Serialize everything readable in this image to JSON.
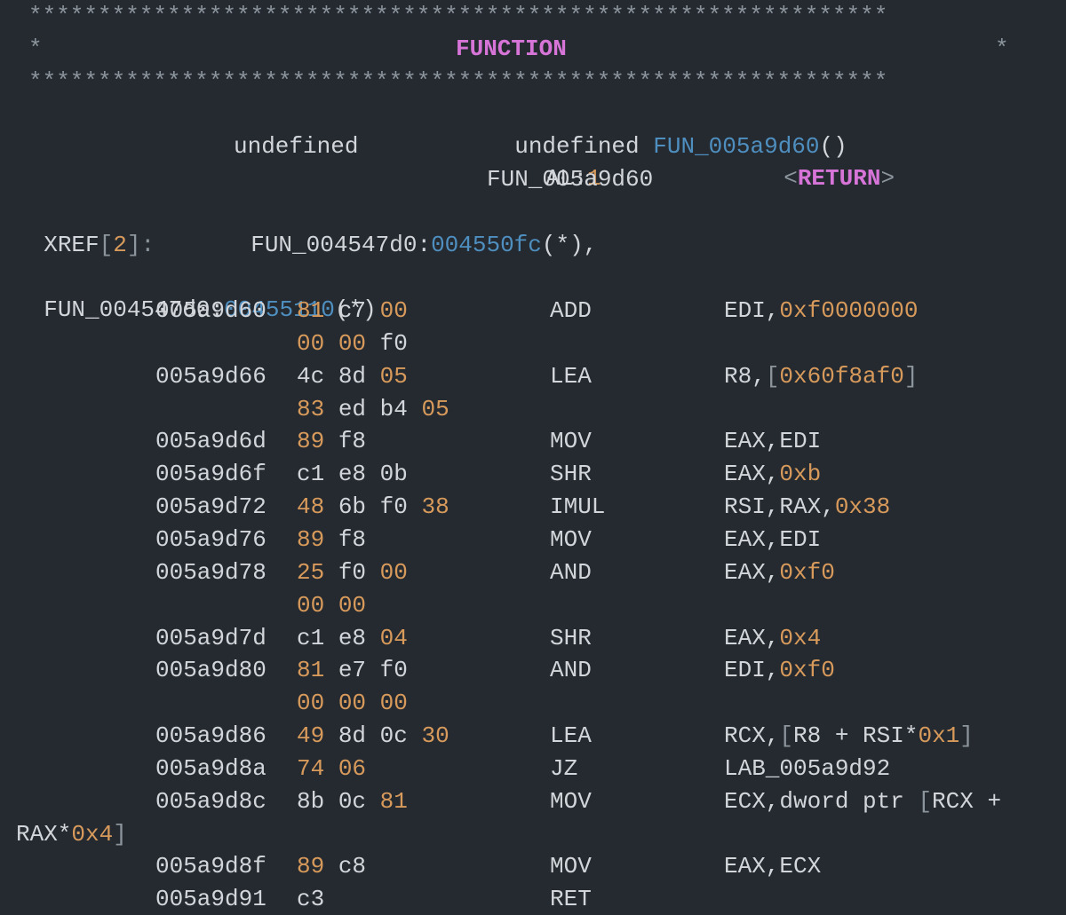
{
  "header": {
    "stars_full": "**************************************************************",
    "left_star": "*",
    "title": "FUNCTION",
    "right_star": "*"
  },
  "signature": {
    "return_type": "undefined",
    "function_name": "FUN_005a9d60",
    "parens": "()"
  },
  "return_row": {
    "type": "undefined",
    "storage_reg": "AL",
    "colon": ":",
    "storage_size": "1",
    "lt": "<",
    "return_label": "RETURN",
    "gt": ">"
  },
  "label": "FUN_005a9d60",
  "xref": {
    "label": "XREF",
    "lbracket": "[",
    "count": "2",
    "rbracket_colon": "]:",
    "ref1_func": "FUN_004547d0:",
    "ref1_addr": "004550fc",
    "ref1_suffix": "(*),",
    "ref2_func": "FUN_004547d0:",
    "ref2_addr": "00455110",
    "ref2_suffix": "(*)"
  },
  "instructions": [
    {
      "address": "005a9d60",
      "bytes": [
        {
          "t": "81",
          "c": "orange"
        },
        {
          "t": "c7",
          "c": "white"
        },
        {
          "t": "00",
          "c": "orange"
        }
      ],
      "mnemonic": "ADD",
      "operands": [
        {
          "t": "EDI,",
          "c": "white"
        },
        {
          "t": "0xf0000000",
          "c": "orange"
        }
      ],
      "cont_bytes": [
        {
          "t": "00",
          "c": "orange"
        },
        {
          "t": "00",
          "c": "orange"
        },
        {
          "t": "f0",
          "c": "white"
        }
      ]
    },
    {
      "address": "005a9d66",
      "bytes": [
        {
          "t": "4c",
          "c": "white"
        },
        {
          "t": "8d",
          "c": "white"
        },
        {
          "t": "05",
          "c": "orange"
        }
      ],
      "mnemonic": "LEA",
      "operands": [
        {
          "t": "R8,",
          "c": "white"
        },
        {
          "t": "[",
          "c": "gray"
        },
        {
          "t": "0x60f8af0",
          "c": "orange"
        },
        {
          "t": "]",
          "c": "gray"
        }
      ],
      "cont_bytes": [
        {
          "t": "83",
          "c": "orange"
        },
        {
          "t": "ed",
          "c": "white"
        },
        {
          "t": "b4",
          "c": "white"
        },
        {
          "t": "05",
          "c": "orange"
        }
      ]
    },
    {
      "address": "005a9d6d",
      "bytes": [
        {
          "t": "89",
          "c": "orange"
        },
        {
          "t": "f8",
          "c": "white"
        }
      ],
      "mnemonic": "MOV",
      "operands": [
        {
          "t": "EAX,EDI",
          "c": "white"
        }
      ]
    },
    {
      "address": "005a9d6f",
      "bytes": [
        {
          "t": "c1",
          "c": "white"
        },
        {
          "t": "e8",
          "c": "white"
        },
        {
          "t": "0b",
          "c": "white"
        }
      ],
      "mnemonic": "SHR",
      "operands": [
        {
          "t": "EAX,",
          "c": "white"
        },
        {
          "t": "0xb",
          "c": "orange"
        }
      ]
    },
    {
      "address": "005a9d72",
      "bytes": [
        {
          "t": "48",
          "c": "orange"
        },
        {
          "t": "6b",
          "c": "white"
        },
        {
          "t": "f0",
          "c": "white"
        },
        {
          "t": "38",
          "c": "orange"
        }
      ],
      "mnemonic": "IMUL",
      "operands": [
        {
          "t": "RSI,RAX,",
          "c": "white"
        },
        {
          "t": "0x38",
          "c": "orange"
        }
      ]
    },
    {
      "address": "005a9d76",
      "bytes": [
        {
          "t": "89",
          "c": "orange"
        },
        {
          "t": "f8",
          "c": "white"
        }
      ],
      "mnemonic": "MOV",
      "operands": [
        {
          "t": "EAX,EDI",
          "c": "white"
        }
      ]
    },
    {
      "address": "005a9d78",
      "bytes": [
        {
          "t": "25",
          "c": "orange"
        },
        {
          "t": "f0",
          "c": "white"
        },
        {
          "t": "00",
          "c": "orange"
        }
      ],
      "mnemonic": "AND",
      "operands": [
        {
          "t": "EAX,",
          "c": "white"
        },
        {
          "t": "0xf0",
          "c": "orange"
        }
      ],
      "cont_bytes": [
        {
          "t": "00",
          "c": "orange"
        },
        {
          "t": "00",
          "c": "orange"
        }
      ]
    },
    {
      "address": "005a9d7d",
      "bytes": [
        {
          "t": "c1",
          "c": "white"
        },
        {
          "t": "e8",
          "c": "white"
        },
        {
          "t": "04",
          "c": "orange"
        }
      ],
      "mnemonic": "SHR",
      "operands": [
        {
          "t": "EAX,",
          "c": "white"
        },
        {
          "t": "0x4",
          "c": "orange"
        }
      ]
    },
    {
      "address": "005a9d80",
      "bytes": [
        {
          "t": "81",
          "c": "orange"
        },
        {
          "t": "e7",
          "c": "white"
        },
        {
          "t": "f0",
          "c": "white"
        }
      ],
      "mnemonic": "AND",
      "operands": [
        {
          "t": "EDI,",
          "c": "white"
        },
        {
          "t": "0xf0",
          "c": "orange"
        }
      ],
      "cont_bytes": [
        {
          "t": "00",
          "c": "orange"
        },
        {
          "t": "00",
          "c": "orange"
        },
        {
          "t": "00",
          "c": "orange"
        }
      ]
    },
    {
      "address": "005a9d86",
      "bytes": [
        {
          "t": "49",
          "c": "orange"
        },
        {
          "t": "8d",
          "c": "white"
        },
        {
          "t": "0c",
          "c": "white"
        },
        {
          "t": "30",
          "c": "orange"
        }
      ],
      "mnemonic": "LEA",
      "operands": [
        {
          "t": "RCX,",
          "c": "white"
        },
        {
          "t": "[",
          "c": "gray"
        },
        {
          "t": "R8 + RSI*",
          "c": "white"
        },
        {
          "t": "0x1",
          "c": "orange"
        },
        {
          "t": "]",
          "c": "gray"
        }
      ]
    },
    {
      "address": "005a9d8a",
      "bytes": [
        {
          "t": "74",
          "c": "orange"
        },
        {
          "t": "06",
          "c": "orange"
        }
      ],
      "mnemonic": "JZ",
      "operands": [
        {
          "t": "LAB_005a9d92",
          "c": "white"
        }
      ]
    },
    {
      "address": "005a9d8c",
      "bytes": [
        {
          "t": "8b",
          "c": "white"
        },
        {
          "t": "0c",
          "c": "white"
        },
        {
          "t": "81",
          "c": "orange"
        }
      ],
      "mnemonic": "MOV",
      "operands": [
        {
          "t": "ECX,dword ptr ",
          "c": "white"
        },
        {
          "t": "[",
          "c": "gray"
        },
        {
          "t": "RCX +",
          "c": "white"
        }
      ],
      "wrap": [
        {
          "t": "RAX*",
          "c": "white"
        },
        {
          "t": "0x4",
          "c": "orange"
        },
        {
          "t": "]",
          "c": "gray"
        }
      ]
    },
    {
      "address": "005a9d8f",
      "bytes": [
        {
          "t": "89",
          "c": "orange"
        },
        {
          "t": "c8",
          "c": "white"
        }
      ],
      "mnemonic": "MOV",
      "operands": [
        {
          "t": "EAX,ECX",
          "c": "white"
        }
      ]
    },
    {
      "address": "005a9d91",
      "bytes": [
        {
          "t": "c3",
          "c": "white"
        }
      ],
      "mnemonic": "RET",
      "operands": []
    }
  ]
}
